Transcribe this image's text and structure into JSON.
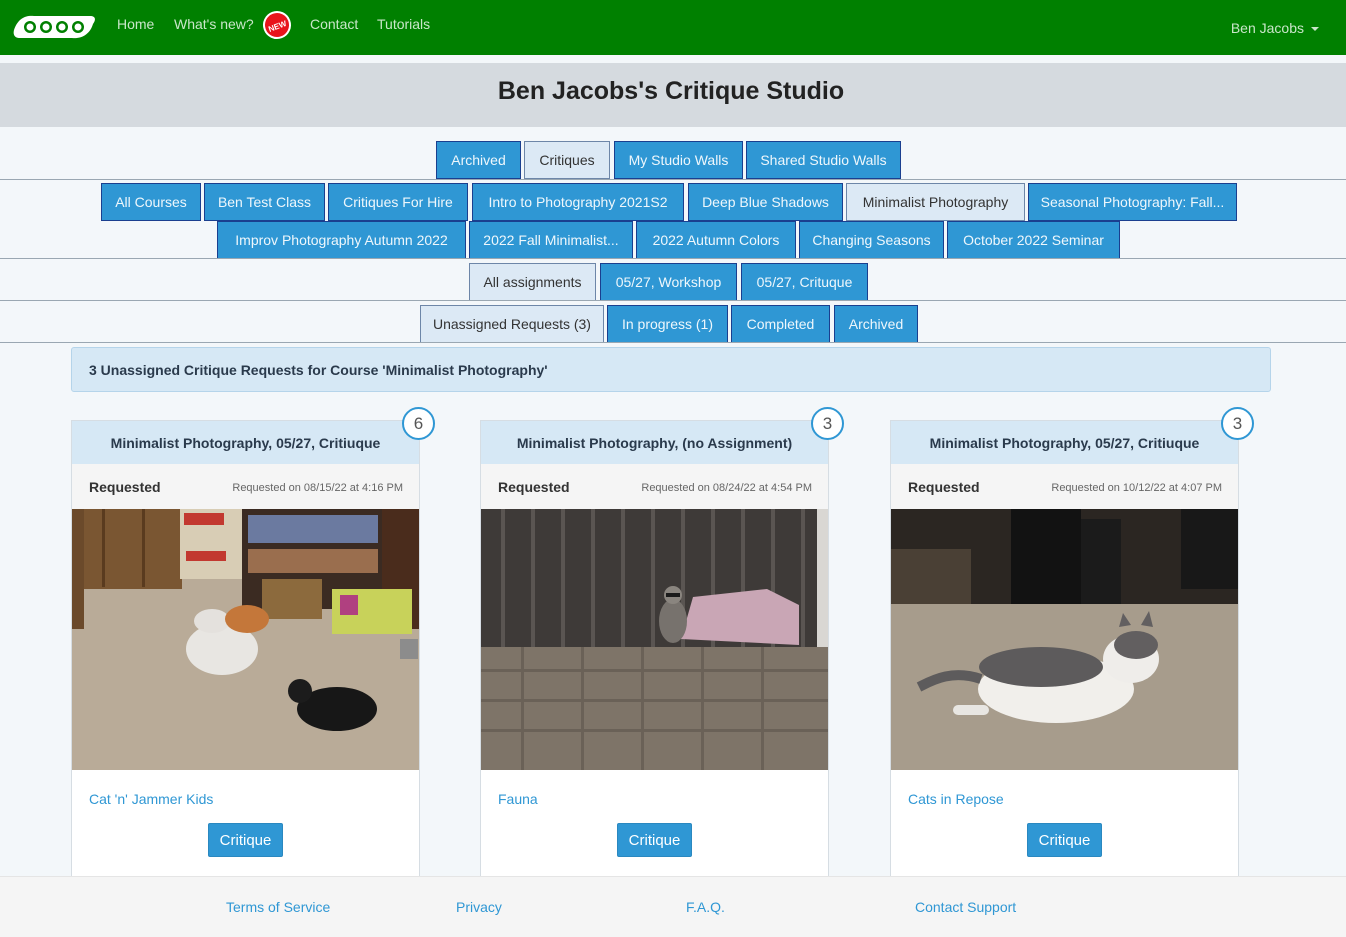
{
  "nav": {
    "logo_icon": "oooo-logo-icon",
    "links": [
      {
        "label": "Home"
      },
      {
        "label": "What's new?"
      },
      {
        "label": "Contact"
      },
      {
        "label": "Tutorials"
      }
    ],
    "new_badge": "NEW",
    "user": "Ben Jacobs"
  },
  "page_title": "Ben Jacobs's Critique Studio",
  "tabs_row1": [
    {
      "label": "Archived",
      "active": false
    },
    {
      "label": "Critiques",
      "active": true
    },
    {
      "label": "My Studio Walls",
      "active": false
    },
    {
      "label": "Shared Studio Walls",
      "active": false
    }
  ],
  "course_tabs": [
    {
      "label": "All Courses",
      "active": false
    },
    {
      "label": "Ben Test Class",
      "active": false
    },
    {
      "label": "Critiques For Hire",
      "active": false
    },
    {
      "label": "Intro to Photography 2021S2",
      "active": false
    },
    {
      "label": "Deep Blue Shadows",
      "active": false
    },
    {
      "label": "Minimalist Photography",
      "active": true
    },
    {
      "label": "Seasonal Photography: Fall...",
      "active": false
    },
    {
      "label": "Improv Photography Autumn 2022",
      "active": false
    },
    {
      "label": "2022 Fall Minimalist...",
      "active": false
    },
    {
      "label": "2022 Autumn Colors",
      "active": false
    },
    {
      "label": "Changing Seasons",
      "active": false
    },
    {
      "label": "October 2022 Seminar",
      "active": false
    }
  ],
  "assignment_tabs": [
    {
      "label": "All assignments",
      "active": true
    },
    {
      "label": "05/27, Workshop",
      "active": false
    },
    {
      "label": "05/27, Crituque",
      "active": false
    }
  ],
  "status_tabs": [
    {
      "label": "Unassigned Requests (3)",
      "active": true
    },
    {
      "label": "In progress (1)",
      "active": false
    },
    {
      "label": "Completed",
      "active": false
    },
    {
      "label": "Archived",
      "active": false
    }
  ],
  "notice": "3 Unassigned Critique Requests for Course 'Minimalist Photography'",
  "cards": [
    {
      "header": "Minimalist Photography, 05/27, Critiuque",
      "count": "6",
      "status": "Requested",
      "date": "Requested on 08/15/22 at 4:16 PM",
      "title": "Cat 'n' Jammer Kids",
      "button": "Critique",
      "photo": "cats-in-room-photo"
    },
    {
      "header": "Minimalist Photography, (no Assignment)",
      "count": "3",
      "status": "Requested",
      "date": "Requested on 08/24/22 at 4:54 PM",
      "title": "Fauna",
      "button": "Critique",
      "photo": "raccoon-on-wall-photo"
    },
    {
      "header": "Minimalist Photography, 05/27, Critiuque",
      "count": "3",
      "status": "Requested",
      "date": "Requested on 10/12/22 at 4:07 PM",
      "title": "Cats in Repose",
      "button": "Critique",
      "photo": "cat-lying-photo"
    }
  ],
  "footer": {
    "terms": "Terms of Service",
    "privacy": "Privacy",
    "faq": "F.A.Q.",
    "support": "Contact Support"
  },
  "colors": {
    "navbar": "#008000",
    "tab": "#2f97d4",
    "tab_active": "#dce9f5",
    "link": "#2f97d4"
  }
}
